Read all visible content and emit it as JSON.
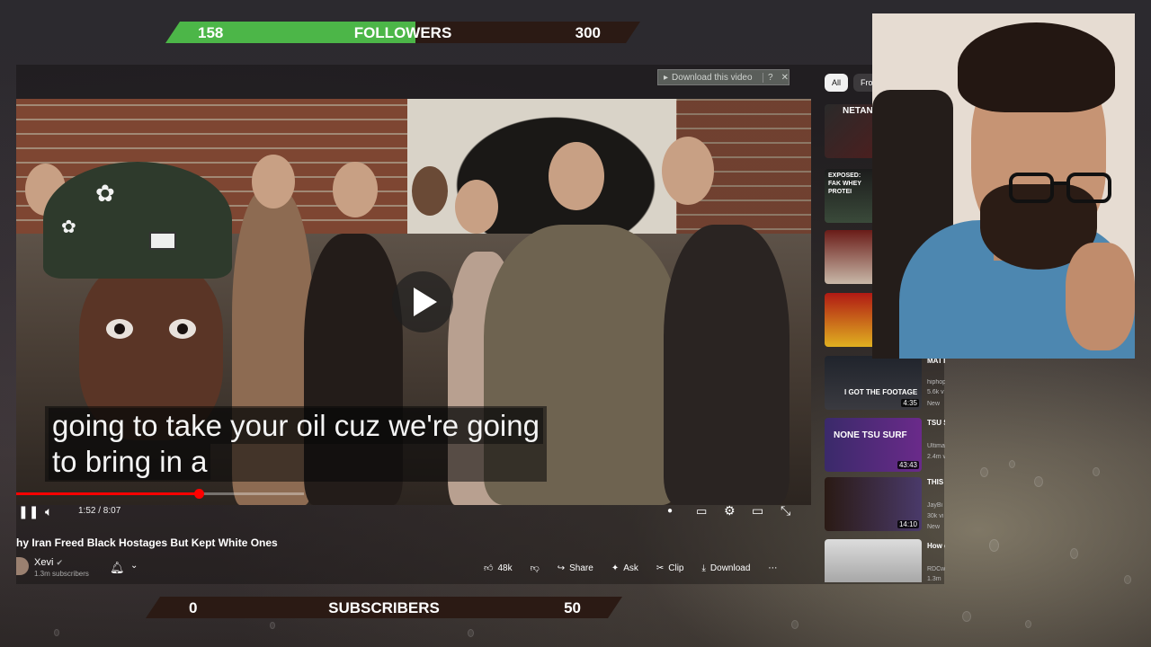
{
  "followers_goal": {
    "current": "158",
    "label": "FOLLOWERS",
    "target": "300",
    "progress": 0.527,
    "fill_color": "#4cb648"
  },
  "subscribers_goal": {
    "current": "0",
    "label": "SUBSCRIBERS",
    "target": "50",
    "progress": 0.0
  },
  "extension": {
    "download_label": "Download this video",
    "help": "?",
    "close": "✕"
  },
  "player": {
    "caption_line1": "going to take your oil cuz we're going",
    "caption_line2": "to bring in a",
    "time": "1:52 / 8:07",
    "progress": 0.23,
    "progress_color": "#ff0000"
  },
  "video": {
    "title": "hy Iran Freed Black Hostages But Kept White Ones",
    "channel": "Xevi",
    "verified_icon": "check-circle-icon",
    "subscribers": "1.3m subscribers",
    "likes": "48k",
    "share": "Share",
    "ask": "Ask",
    "clip": "Clip",
    "download": "Download",
    "more": "⋯"
  },
  "sidebar": {
    "chips": [
      {
        "label": "All",
        "active": true
      },
      {
        "label": "Fro",
        "active": false
      }
    ],
    "recs": [
      {
        "thumb_text": "NETAN DEA",
        "title": "",
        "duration": ""
      },
      {
        "thumb_text": "EXPOSED: FAK WHEY PROTEI",
        "title": "",
        "duration": ""
      },
      {
        "thumb_text": "",
        "title": "",
        "duration": ""
      },
      {
        "thumb_text": "",
        "title": "",
        "duration": ""
      },
      {
        "thumb_text": "I GOT THE FOOTAGE",
        "title": "MATT REX G",
        "meta1": "hiphop",
        "meta2": "5.6k v",
        "badge": "New",
        "duration": "4:35"
      },
      {
        "thumb_text": "NONE TSU SURF",
        "title": "TSU S SMAC",
        "meta1": "Ultima",
        "meta2": "2.4m v",
        "badge": "",
        "duration": "43:43"
      },
      {
        "thumb_text": "",
        "title": "THIS YOU?",
        "meta1": "JayBi",
        "meta2": "30k vi",
        "badge": "New",
        "duration": "14:10"
      },
      {
        "thumb_text": "",
        "title": "How dropp",
        "meta1": "RDCw",
        "meta2": "1.3m",
        "badge": "",
        "duration": ""
      }
    ]
  }
}
